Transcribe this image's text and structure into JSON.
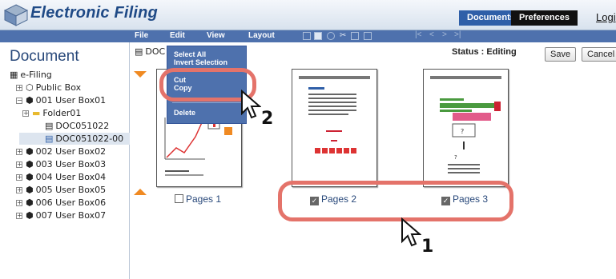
{
  "header": {
    "app_title": "Electronic Filing",
    "tabs": [
      "Documents",
      "Preferences"
    ],
    "logout": "Logi"
  },
  "menubar": {
    "items": [
      "File",
      "Edit",
      "View",
      "Layout"
    ],
    "toolbar_icons": [
      "thumbnail-view-icon",
      "save-icon",
      "globe-icon",
      "cut-icon",
      "copy-icon",
      "paste-icon"
    ],
    "nav_arrows": [
      "|<",
      "<",
      ">",
      ">|"
    ]
  },
  "sidebar": {
    "heading": "Document",
    "tree": [
      {
        "label": "e-Filing",
        "icon": "efiling-icon"
      },
      {
        "label": "Public Box",
        "icon": "box-icon"
      },
      {
        "label": "001 User Box01",
        "icon": "user-box-icon"
      },
      {
        "label": "Folder01",
        "icon": "folder-icon"
      },
      {
        "label": "DOC051022",
        "icon": "document-icon"
      },
      {
        "label": "DOC051022-00",
        "icon": "document-icon"
      },
      {
        "label": "002 User Box02",
        "icon": "user-box-icon"
      },
      {
        "label": "003 User Box03",
        "icon": "user-box-icon"
      },
      {
        "label": "004 User Box04",
        "icon": "user-box-icon"
      },
      {
        "label": "005 User Box05",
        "icon": "user-box-icon"
      },
      {
        "label": "006 User Box06",
        "icon": "user-box-icon"
      },
      {
        "label": "007 User Box07",
        "icon": "user-box-icon"
      }
    ]
  },
  "main": {
    "crumb": "DOC",
    "status": "Status : Editing",
    "save_label": "Save",
    "cancel_label": "Cancel",
    "pages": [
      {
        "label": "Pages 1",
        "checked": false
      },
      {
        "label": "Pages 2",
        "checked": true
      },
      {
        "label": "Pages 3",
        "checked": true
      }
    ]
  },
  "edit_menu": {
    "select_all": "Select All",
    "invert_selection": "Invert Selection",
    "cut": "Cut",
    "copy": "Copy",
    "delete": "Delete"
  },
  "callouts": {
    "step1": "1",
    "step2": "2"
  },
  "colors": {
    "accent": "#4e71ad",
    "highlight": "#e4736a",
    "orange": "#f08a22"
  }
}
